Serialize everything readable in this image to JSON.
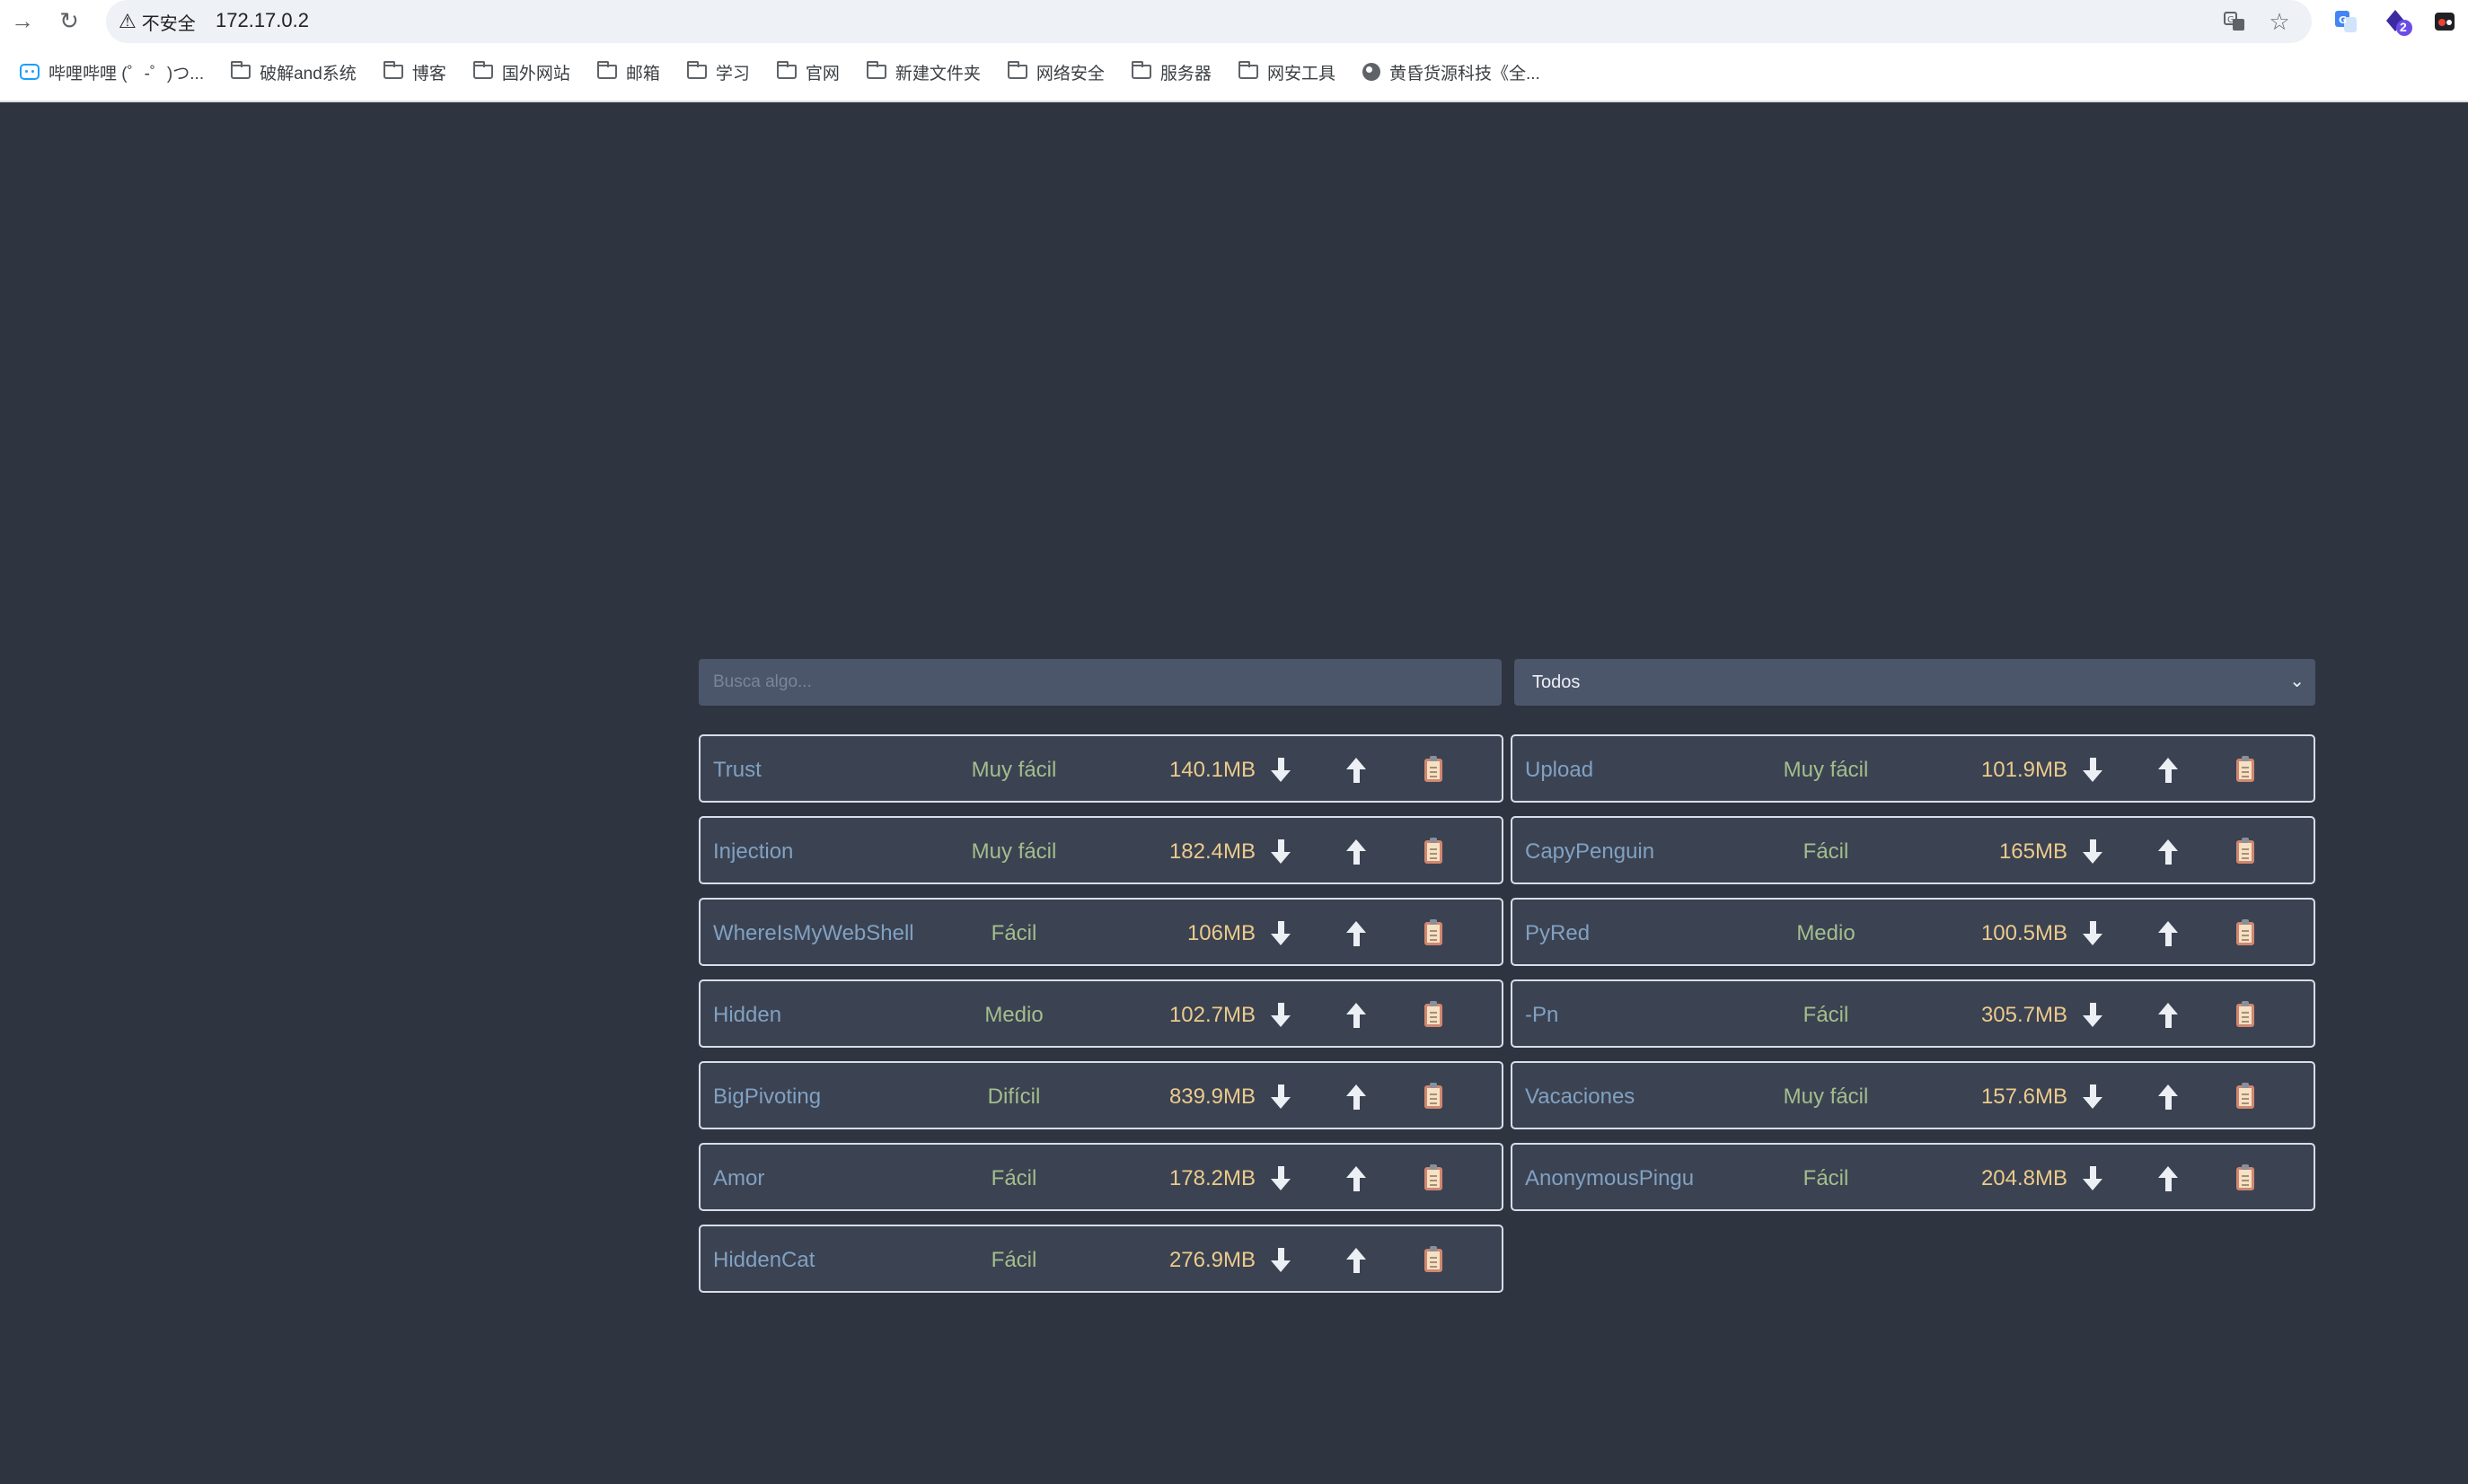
{
  "browser": {
    "security_label": "不安全",
    "url": "172.17.0.2",
    "extension_badge": "2",
    "bookmarks": [
      {
        "label": "哔哩哔哩 (゜-゜)つ...",
        "icon": "bilibili-icon"
      },
      {
        "label": "破解and系统",
        "icon": "folder-icon"
      },
      {
        "label": "博客",
        "icon": "folder-icon"
      },
      {
        "label": "国外网站",
        "icon": "folder-icon"
      },
      {
        "label": "邮箱",
        "icon": "folder-icon"
      },
      {
        "label": "学习",
        "icon": "folder-icon"
      },
      {
        "label": "官网",
        "icon": "folder-icon"
      },
      {
        "label": "新建文件夹",
        "icon": "folder-icon"
      },
      {
        "label": "网络安全",
        "icon": "folder-icon"
      },
      {
        "label": "服务器",
        "icon": "folder-icon"
      },
      {
        "label": "网安工具",
        "icon": "folder-icon"
      },
      {
        "label": "黄昏货源科技《全...",
        "icon": "globe-icon"
      }
    ]
  },
  "search": {
    "placeholder": "Busca algo..."
  },
  "filter": {
    "selected": "Todos"
  },
  "colors": {
    "background": "#2e3440",
    "card": "#3b4252",
    "name": "#81a1c1",
    "difficulty": "#a3be8c",
    "size": "#ebcb8b"
  },
  "machines": [
    {
      "name": "Trust",
      "difficulty": "Muy fácil",
      "size": "140.1MB"
    },
    {
      "name": "Upload",
      "difficulty": "Muy fácil",
      "size": "101.9MB"
    },
    {
      "name": "Injection",
      "difficulty": "Muy fácil",
      "size": "182.4MB"
    },
    {
      "name": "CapyPenguin",
      "difficulty": "Fácil",
      "size": "165MB"
    },
    {
      "name": "WhereIsMyWebShell",
      "difficulty": "Fácil",
      "size": "106MB"
    },
    {
      "name": "PyRed",
      "difficulty": "Medio",
      "size": "100.5MB"
    },
    {
      "name": "Hidden",
      "difficulty": "Medio",
      "size": "102.7MB"
    },
    {
      "name": "-Pn",
      "difficulty": "Fácil",
      "size": "305.7MB"
    },
    {
      "name": "BigPivoting",
      "difficulty": "Difícil",
      "size": "839.9MB"
    },
    {
      "name": "Vacaciones",
      "difficulty": "Muy fácil",
      "size": "157.6MB"
    },
    {
      "name": "Amor",
      "difficulty": "Fácil",
      "size": "178.2MB"
    },
    {
      "name": "AnonymousPingu",
      "difficulty": "Fácil",
      "size": "204.8MB"
    },
    {
      "name": "HiddenCat",
      "difficulty": "Fácil",
      "size": "276.9MB"
    }
  ]
}
